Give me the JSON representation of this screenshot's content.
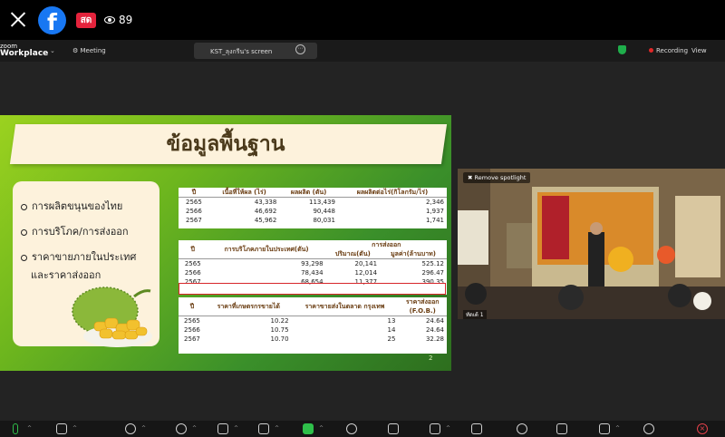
{
  "facebook": {
    "live_label": "สด",
    "viewer_count": "89"
  },
  "zoom": {
    "brand_top": "zoom",
    "brand_bottom": "Workplace",
    "meeting_label": "Meeting",
    "share_tab_label": "KST_ลุงกรีน's screen",
    "recording_label": "Recording",
    "view_label": "View"
  },
  "slide": {
    "title": "ข้อมูลพื้นฐาน",
    "bullets": [
      "การผลิตขนุนของไทย",
      "การบริโภค/การส่งออก",
      "ราคาขายภายในประเทศ",
      "และราคาส่งออก"
    ],
    "page_number": "2",
    "table1": {
      "headers": [
        "ปี",
        "เนื้อที่ให้ผล (ไร่)",
        "ผลผลิต (ตัน)",
        "ผลผลิตต่อไร่(กิโลกรัม/ไร่)"
      ],
      "rows": [
        [
          "2565",
          "43,338",
          "113,439",
          "2,346"
        ],
        [
          "2566",
          "46,692",
          "90,448",
          "1,937"
        ],
        [
          "2567",
          "45,962",
          "80,031",
          "1,741"
        ]
      ]
    },
    "table2": {
      "headers": [
        "ปี",
        "การบริโภคภายในประเทศ(ตัน)",
        "การส่งออก",
        "ปริมาณ(ตัน)",
        "มูลค่า(ล้านบาท)"
      ],
      "rows": [
        [
          "2565",
          "93,298",
          "20,141",
          "525.12"
        ],
        [
          "2566",
          "78,434",
          "12,014",
          "296.47"
        ],
        [
          "2567",
          "68,654",
          "11,377",
          "390.35"
        ]
      ]
    },
    "table3": {
      "headers": [
        "ปี",
        "ราคาที่เกษตรกรขายได้",
        "ราคาขายส่งในตลาด กรุงเทพ",
        "ราคาส่งออก",
        "(F.O.B.)"
      ],
      "rows": [
        [
          "2565",
          "10.22",
          "13",
          "24.64"
        ],
        [
          "2566",
          "10.75",
          "14",
          "24.64"
        ],
        [
          "2567",
          "10.70",
          "25",
          "32.28"
        ]
      ]
    }
  },
  "video": {
    "spotlight_label": "Remove spotlight",
    "participant_name": "ทัดเต้ 1"
  }
}
